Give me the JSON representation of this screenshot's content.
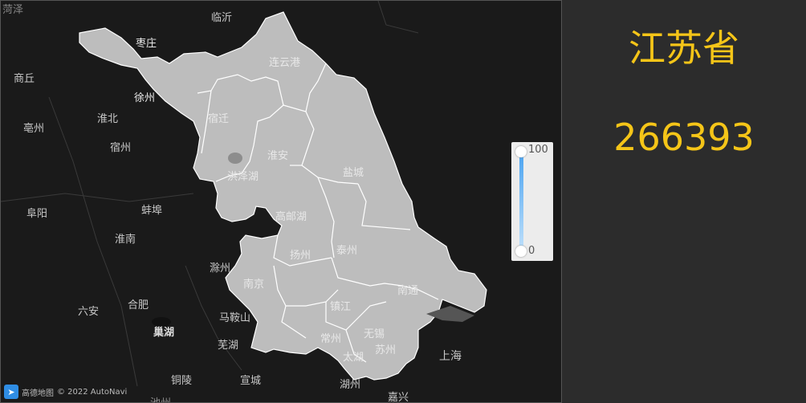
{
  "map": {
    "cities": [
      "临沂",
      "枣庄",
      "商丘",
      "徐州",
      "淮北",
      "亳州",
      "宿州",
      "宿迁",
      "连云港",
      "淮安",
      "盐城",
      "洪泽湖",
      "阜阳",
      "蚌埠",
      "高邮湖",
      "淮南",
      "扬州",
      "泰州",
      "滁州",
      "南京",
      "南通",
      "六安",
      "合肥",
      "镇江",
      "马鞍山",
      "巢湖",
      "芜湖",
      "常州",
      "无锡",
      "太湖",
      "苏州",
      "上海",
      "铜陵",
      "宣城",
      "湖州",
      "嘉兴",
      "池州",
      "菏泽"
    ],
    "region_fill": "#bdbdbd",
    "base_color": "#1a1a1a"
  },
  "legend": {
    "max": "100",
    "min": "0",
    "color_high": "#4aa3f0",
    "color_low": "#bfe0fb"
  },
  "attribution": {
    "logo_text": "高德地图",
    "copyright": "© 2022 AutoNavi"
  },
  "panel": {
    "province": "江苏省",
    "value": "266393",
    "text_color": "#f5c518"
  }
}
